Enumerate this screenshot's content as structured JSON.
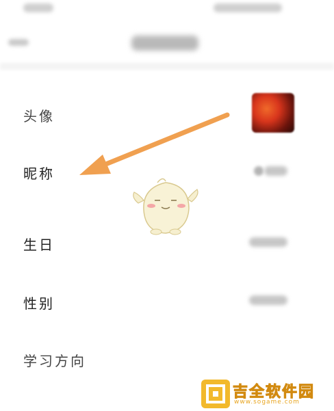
{
  "rows": [
    {
      "label": "头像"
    },
    {
      "label": "昵称"
    },
    {
      "label": "生日"
    },
    {
      "label": "性别"
    },
    {
      "label": "学习方向"
    }
  ],
  "watermark": {
    "text": "吉全软件园",
    "sub": "www.sogame.com",
    "color": "#f2b92c"
  },
  "colors": {
    "arrow": "#f0a050",
    "background": "#ffffff"
  }
}
